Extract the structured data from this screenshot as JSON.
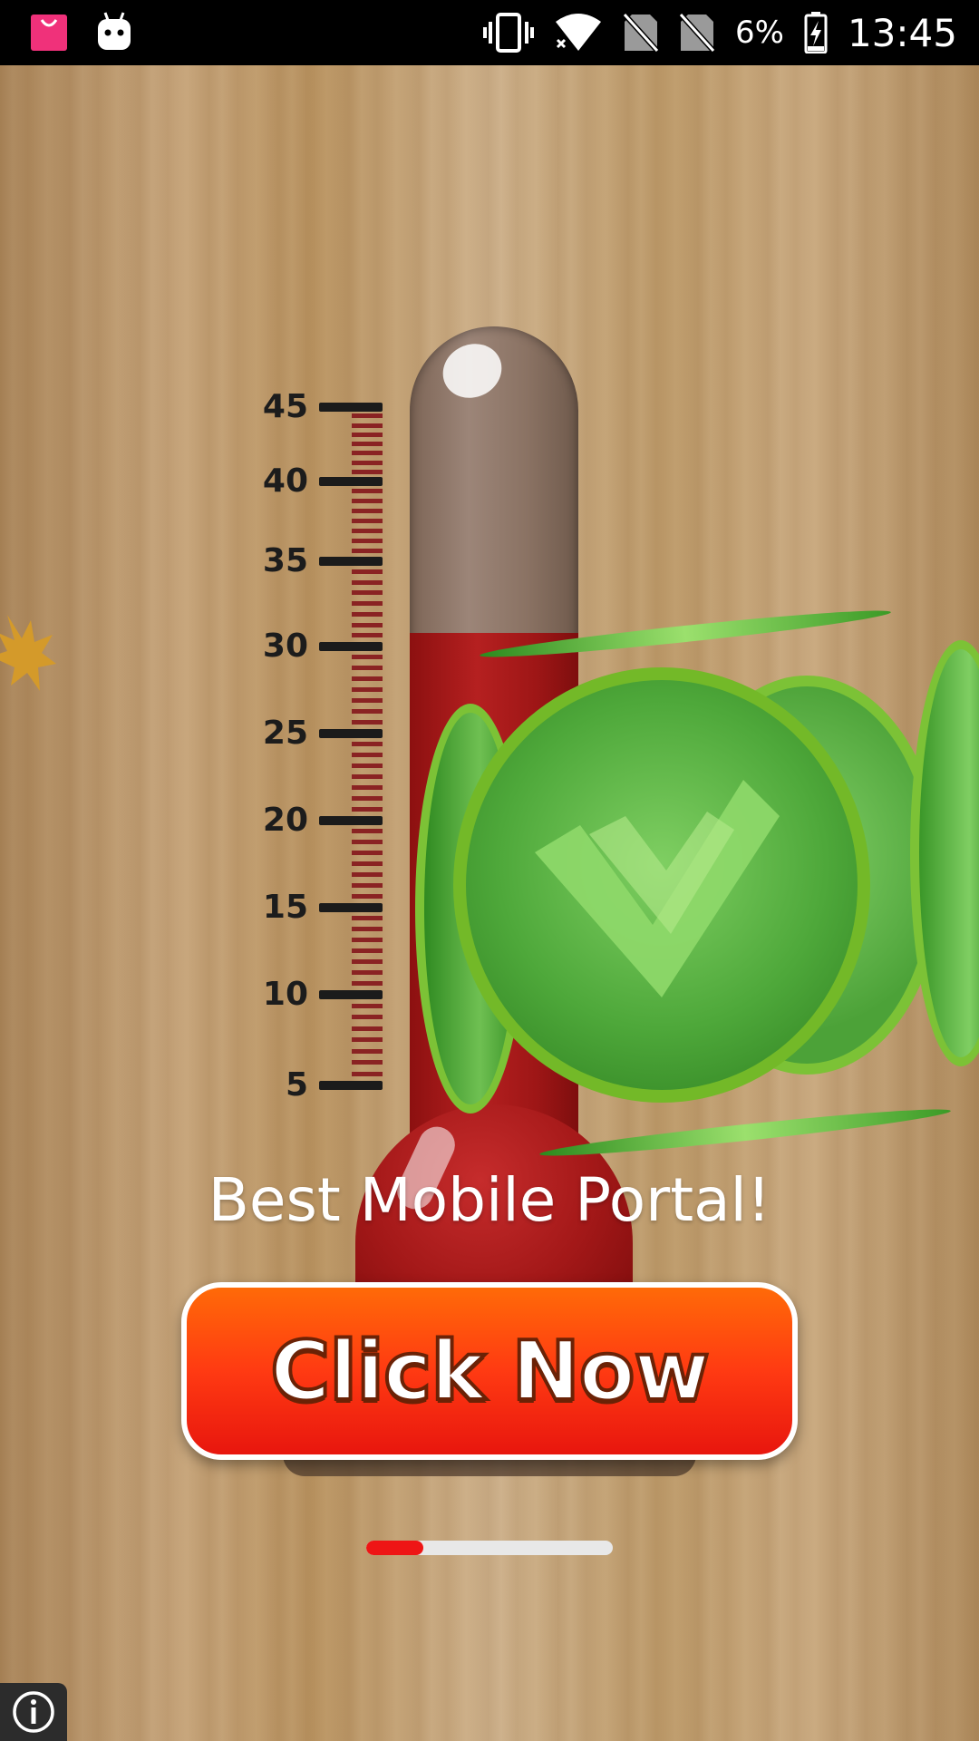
{
  "status_bar": {
    "battery_percent": "6%",
    "time": "13:45",
    "icons": [
      "shopping-bag-icon",
      "android-debug-icon",
      "vibrate-icon",
      "wifi-icon",
      "no-sim-icon",
      "no-sim-icon",
      "battery-charging-icon"
    ]
  },
  "thermometer": {
    "scale_labels": [
      "45",
      "40",
      "35",
      "30",
      "25",
      "20",
      "15",
      "10",
      "5"
    ],
    "level": 30,
    "fluid_color": "#a31818"
  },
  "ad": {
    "headline": "Best Mobile Portal!",
    "cta_label": "Click Now",
    "cta_color": "#ff3a12",
    "progress_fraction": 0.23
  },
  "info_button": {
    "icon": "info-icon"
  }
}
